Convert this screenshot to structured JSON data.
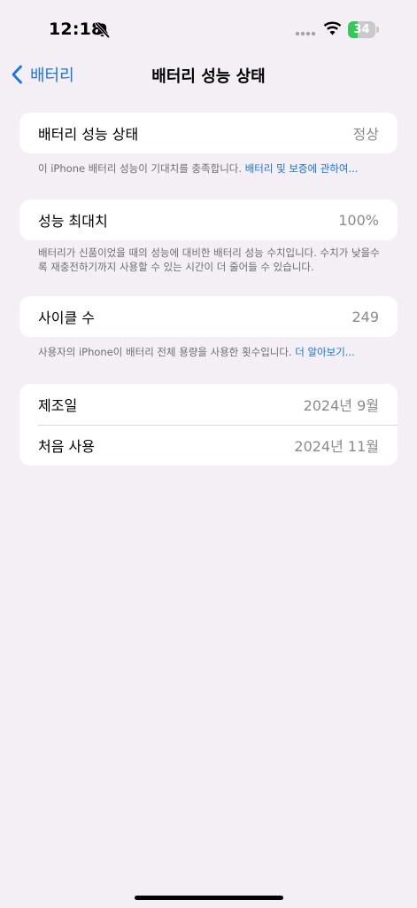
{
  "status_bar": {
    "time": "12:18",
    "battery_level": "34",
    "battery_fraction": 0.34,
    "silent_mode": true,
    "icons": [
      "bell-slash-icon",
      "signal-dots-icon",
      "wifi-icon",
      "battery-icon"
    ]
  },
  "nav": {
    "back_label": "배터리",
    "title": "배터리 성능 상태"
  },
  "health": {
    "label": "배터리 성능 상태",
    "value": "정상",
    "footnote": "이 iPhone 배터리 성능이 기대치를 충족합니다.",
    "footnote_link": "배터리 및 보증에 관하여..."
  },
  "max_capacity": {
    "label": "성능 최대치",
    "value": "100%",
    "footnote": "배터리가 신품이었을 때의 성능에 대비한 배터리 성능 수치입니다. 수치가 낮을수록 재충전하기까지 사용할 수 있는 시간이 더 줄어들 수 있습니다."
  },
  "cycle_count": {
    "label": "사이클 수",
    "value": "249",
    "footnote": "사용자의 iPhone이 배터리 전체 용량을 사용한 횟수입니다.",
    "footnote_link": "더 알아보기..."
  },
  "dates": {
    "manufacture_label": "제조일",
    "manufacture_value": "2024년 9월",
    "first_use_label": "처음 사용",
    "first_use_value": "2024년 11월"
  },
  "colors": {
    "accent": "#1a73e8",
    "background": "#f3eff5",
    "battery_green": "#34c759"
  }
}
